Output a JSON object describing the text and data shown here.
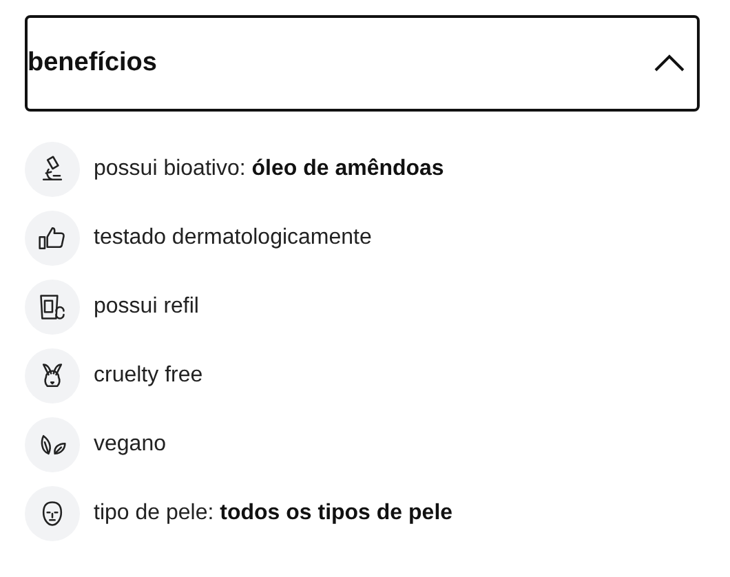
{
  "accordion": {
    "title": "benefícios",
    "expanded": true
  },
  "benefits": [
    {
      "kind": "microscope",
      "text": "possui bioativo: **óleo de amêndoas**"
    },
    {
      "kind": "thumb",
      "text": "testado dermatologicamente"
    },
    {
      "kind": "refill",
      "text": "possui refil"
    },
    {
      "kind": "rabbit",
      "text": "cruelty free"
    },
    {
      "kind": "leaf",
      "text": "vegano"
    },
    {
      "kind": "face",
      "text": "tipo de pele: **todos os tipos de pele**"
    }
  ]
}
